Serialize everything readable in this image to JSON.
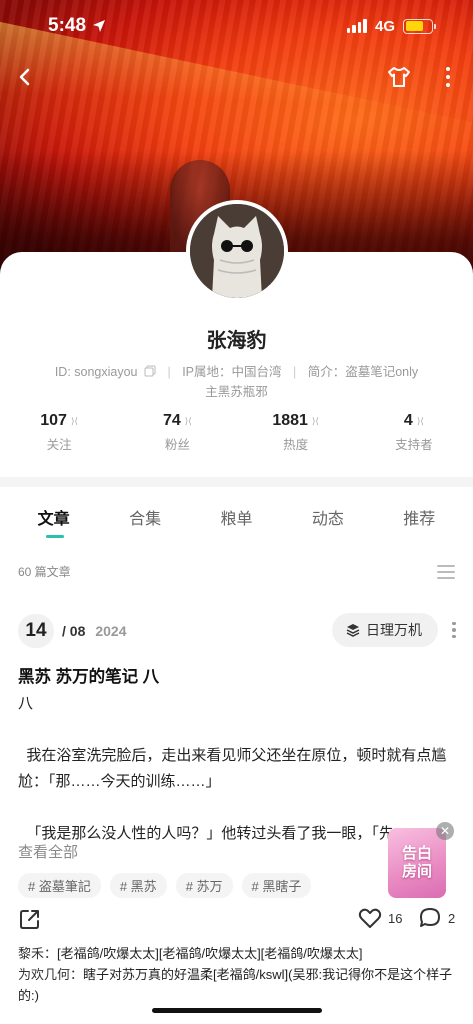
{
  "status_bar": {
    "time": "5:48",
    "network": "4G"
  },
  "profile": {
    "name": "张海豹",
    "id_text": "ID: songxiayou",
    "ip_text": "IP属地：中国台湾",
    "bio_text": "简介：盗墓笔记only",
    "bio_line2": "主黑苏瓶邪",
    "stats": [
      {
        "num": "107",
        "label": "关注"
      },
      {
        "num": "74",
        "label": "粉丝"
      },
      {
        "num": "1881",
        "label": "热度"
      },
      {
        "num": "4",
        "label": "支持者"
      }
    ]
  },
  "tabs": [
    "文章",
    "合集",
    "粮单",
    "动态",
    "推荐"
  ],
  "article_count": "60 篇文章",
  "post": {
    "day": "14",
    "month": "/ 08",
    "year": "2024",
    "collection": "日理万机",
    "title": "黑苏 苏万的笔记 八",
    "body": "八\n\n  我在浴室洗完脸后，走出来看见师父还坐在原位，顿时就有点尴尬：「那……今天的训练……」\n\n  「我是那么没人性的人吗？」他转过头看了我一眼，「先",
    "view_all": "查看全部",
    "tags": [
      "# 盗墓筆記",
      "# 黑苏",
      "# 苏万",
      "# 黑瞎子"
    ],
    "likes": "16",
    "comments_count": "2",
    "comments": [
      {
        "who": "黎禾：",
        "text": "[老福鸽/吹爆太太][老福鸽/吹爆太太][老福鸽/吹爆太太]"
      },
      {
        "who": "为欢几何：",
        "text": "瞎子对苏万真的好温柔[老福鸽/kswl](吴邪:我记得你不是这个样子的:)"
      }
    ]
  },
  "ad": {
    "line1": "告白",
    "line2": "房间"
  },
  "colors": {
    "accent": "#2bbfb0",
    "battery": "#ffd60a"
  }
}
